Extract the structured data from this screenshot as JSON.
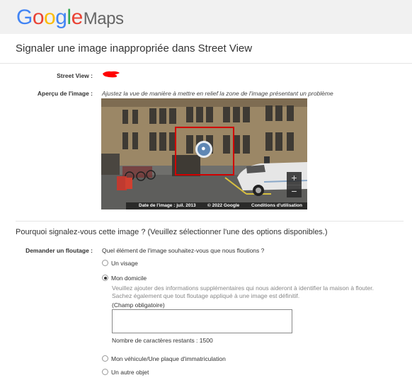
{
  "logo": {
    "google": "Google",
    "maps": "Maps"
  },
  "page": {
    "title": "Signaler une image inappropriée dans Street View"
  },
  "fields": {
    "street_view_label": "Street View :",
    "preview_label": "Aperçu de l'image :",
    "preview_hint": "Ajustez la vue de manière à mettre en relief la zone de l'image présentant un problème"
  },
  "viewer": {
    "zoom_in": "+",
    "zoom_out": "−",
    "image_date": "Date de l'image : juil. 2013",
    "copyright": "© 2022 Google",
    "terms": "Conditions d'utilisation"
  },
  "question": "Pourquoi signalez-vous cette image ?  (Veuillez sélectionner l'une des options disponibles.)",
  "blur": {
    "label": "Demander un floutage :",
    "prompt": "Quel élément de l'image souhaitez-vous que nous floutions ?",
    "options": [
      {
        "label": "Un visage",
        "selected": false
      },
      {
        "label": "Mon domicile",
        "selected": true
      },
      {
        "label": "Mon véhicule/Une plaque d'immatriculation",
        "selected": false
      },
      {
        "label": "Un autre objet",
        "selected": false
      }
    ],
    "home_description": "Veuillez ajouter des informations supplémentaires qui nous aideront à identifier la maison à flouter. Sachez également que tout floutage appliqué à une image est définitif.",
    "required_label": "(Champ obligatoire)",
    "textarea_value": "",
    "chars_remaining": "Nombre de caractères restants : 1500"
  },
  "colors": {
    "selection_box": "#d10000",
    "redaction": "#ff0000",
    "topbar": "#f1f1f1"
  }
}
